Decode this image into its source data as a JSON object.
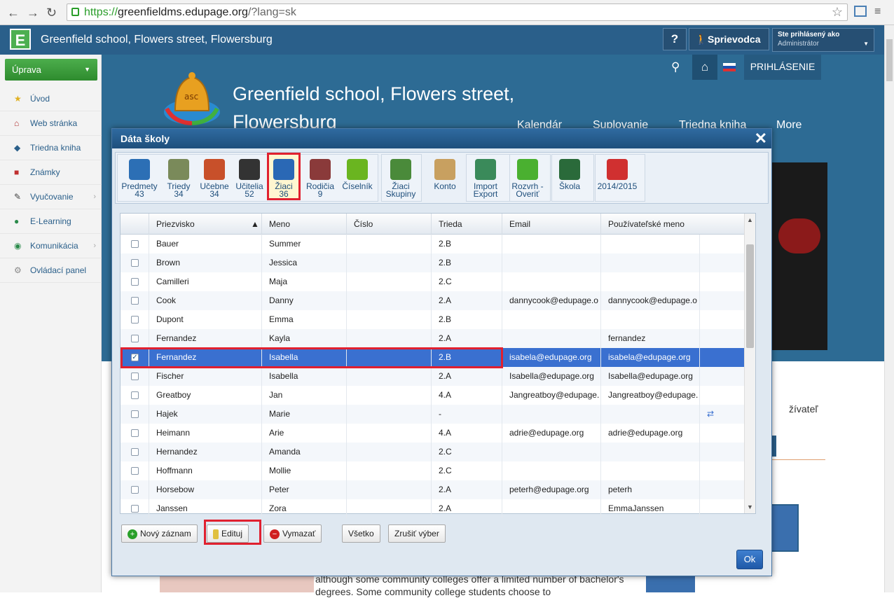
{
  "browser": {
    "url_scheme": "https://",
    "url_host": "greenfieldms.edupage.org",
    "url_rest": "/?lang=sk"
  },
  "topbar": {
    "logo_letter": "E",
    "title": "Greenfield school, Flowers street, Flowersburg",
    "help_label": "?",
    "guide_label": "Sprievodca",
    "logged_label": "Ste prihlásený ako",
    "logged_role": "Administrátor"
  },
  "sidebar": {
    "uprava_label": "Úprava",
    "items": [
      {
        "label": "Úvod",
        "icon": "star-icon",
        "color": "#e0b020"
      },
      {
        "label": "Web stránka",
        "icon": "web-icon",
        "color": "#b03030"
      },
      {
        "label": "Triedna kniha",
        "icon": "book-icon",
        "color": "#2a5f8a"
      },
      {
        "label": "Známky",
        "icon": "grades-icon",
        "color": "#c03030"
      },
      {
        "label": "Vyučovanie",
        "icon": "teaching-icon",
        "color": "#444"
      },
      {
        "label": "E-Learning",
        "icon": "elearning-icon",
        "color": "#2a8a4a"
      },
      {
        "label": "Komunikácia",
        "icon": "communication-icon",
        "color": "#2a8a4a"
      },
      {
        "label": "Ovládací panel",
        "icon": "control-panel-icon",
        "color": "#888"
      }
    ]
  },
  "site": {
    "title": "Greenfield school, Flowers street, Flowersburg",
    "login": "PRIHLÁSENIE",
    "menu": [
      "Kalendár",
      "Suplovanie",
      "Triedna kniha",
      "More"
    ],
    "lower_text": "although some community colleges offer a limited number of bachelor's degrees. Some community college students choose to",
    "lower_user": "žívateľ"
  },
  "modal": {
    "title": "Dáta školy",
    "close": "✕",
    "toolbar": [
      {
        "label": "Predmety",
        "count": "43",
        "icon": "subjects-icon",
        "color": "#2c6fb5"
      },
      {
        "label": "Triedy",
        "count": "34",
        "icon": "classes-icon",
        "color": "#7a8a5a"
      },
      {
        "label": "Učebne",
        "count": "34",
        "icon": "classrooms-icon",
        "color": "#c8502a"
      },
      {
        "label": "Učitelia",
        "count": "52",
        "icon": "teachers-icon",
        "color": "#333"
      },
      {
        "label": "Žiaci",
        "count": "36",
        "icon": "students-icon",
        "color": "#2a68b5"
      },
      {
        "label": "Rodičia",
        "count": "9",
        "icon": "parents-icon",
        "color": "#8a3a3a"
      },
      {
        "label": "Číselník",
        "count": "",
        "icon": "codebook-icon",
        "color": "#6ab520"
      },
      {
        "label": "Žiaci",
        "count": "Skupiny",
        "icon": "student-groups-icon",
        "color": "#4a8a3a"
      },
      {
        "label": "Konto",
        "count": "",
        "icon": "account-icon",
        "color": "#c8a060"
      },
      {
        "label": "Import",
        "count": "Export",
        "icon": "import-export-icon",
        "color": "#3a8a5a"
      },
      {
        "label": "Rozvrh -",
        "count": "Overiť",
        "icon": "timetable-check-icon",
        "color": "#4ab030"
      },
      {
        "label": "Škola",
        "count": "",
        "icon": "school-icon",
        "color": "#2a6a3a"
      },
      {
        "label": "2014/2015",
        "count": "",
        "icon": "year-icon",
        "color": "#d03030"
      }
    ],
    "columns": [
      "Priezvisko",
      "Meno",
      "Číslo",
      "Trieda",
      "Email",
      "Používateľské meno"
    ],
    "rows": [
      {
        "surname": "Bauer",
        "name": "Summer",
        "number": "",
        "class": "2.B",
        "email": "",
        "username": "",
        "checked": ""
      },
      {
        "surname": "Brown",
        "name": "Jessica",
        "number": "",
        "class": "2.B",
        "email": "",
        "username": "",
        "checked": ""
      },
      {
        "surname": "Camilleri",
        "name": "Maja",
        "number": "",
        "class": "2.C",
        "email": "",
        "username": "",
        "checked": ""
      },
      {
        "surname": "Cook",
        "name": "Danny",
        "number": "",
        "class": "2.A",
        "email": "dannycook@edupage.o",
        "username": "dannycook@edupage.o",
        "checked": ""
      },
      {
        "surname": "Dupont",
        "name": "Emma",
        "number": "",
        "class": "2.B",
        "email": "",
        "username": "",
        "checked": ""
      },
      {
        "surname": "Fernandez",
        "name": "Kayla",
        "number": "",
        "class": "2.A",
        "email": "",
        "username": "fernandez",
        "checked": ""
      },
      {
        "surname": "Fernandez",
        "name": "Isabella",
        "number": "",
        "class": "2.B",
        "email": "isabela@edupage.org",
        "username": "isabela@edupage.org",
        "checked": "✓"
      },
      {
        "surname": "Fischer",
        "name": "Isabella",
        "number": "",
        "class": "2.A",
        "email": "Isabella@edupage.org",
        "username": "Isabella@edupage.org",
        "checked": ""
      },
      {
        "surname": "Greatboy",
        "name": "Jan",
        "number": "",
        "class": "4.A",
        "email": "Jangreatboy@edupage.",
        "username": "Jangreatboy@edupage.",
        "checked": ""
      },
      {
        "surname": "Hajek",
        "name": "Marie",
        "number": "",
        "class": "-",
        "email": "",
        "username": "",
        "checked": ""
      },
      {
        "surname": "Heimann",
        "name": "Arie",
        "number": "",
        "class": "4.A",
        "email": "adrie@edupage.org",
        "username": "adrie@edupage.org",
        "checked": ""
      },
      {
        "surname": "Hernandez",
        "name": "Amanda",
        "number": "",
        "class": "2.C",
        "email": "",
        "username": "",
        "checked": ""
      },
      {
        "surname": "Hoffmann",
        "name": "Mollie",
        "number": "",
        "class": "2.C",
        "email": "",
        "username": "",
        "checked": ""
      },
      {
        "surname": "Horsebow",
        "name": "Peter",
        "number": "",
        "class": "2.A",
        "email": "peterh@edupage.org",
        "username": "peterh",
        "checked": ""
      },
      {
        "surname": "Janssen",
        "name": "Zora",
        "number": "",
        "class": "2.A",
        "email": "",
        "username": "EmmaJanssen",
        "checked": ""
      }
    ],
    "buttons": {
      "new": "Nový záznam",
      "edit": "Edituj",
      "delete": "Vymazať",
      "all": "Všetko",
      "cancel_select": "Zrušiť výber",
      "ok": "Ok"
    },
    "accent_red": "#e0202f",
    "selected_row_color": "#3a70d0"
  }
}
